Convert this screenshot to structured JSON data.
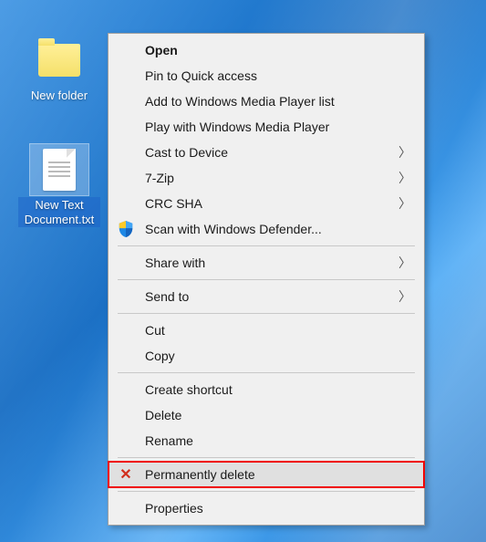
{
  "icons": {
    "folder": {
      "label": "New folder"
    },
    "txt": {
      "label": "New Text Document.txt"
    }
  },
  "menu": {
    "open": "Open",
    "pin": "Pin to Quick access",
    "wmp_add": "Add to Windows Media Player list",
    "wmp_play": "Play with Windows Media Player",
    "cast": "Cast to Device",
    "sevenzip": "7-Zip",
    "crcsha": "CRC SHA",
    "defender": "Scan with Windows Defender...",
    "share": "Share with",
    "sendto": "Send to",
    "cut": "Cut",
    "copy": "Copy",
    "shortcut": "Create shortcut",
    "delete": "Delete",
    "rename": "Rename",
    "permdelete": "Permanently delete",
    "properties": "Properties"
  }
}
